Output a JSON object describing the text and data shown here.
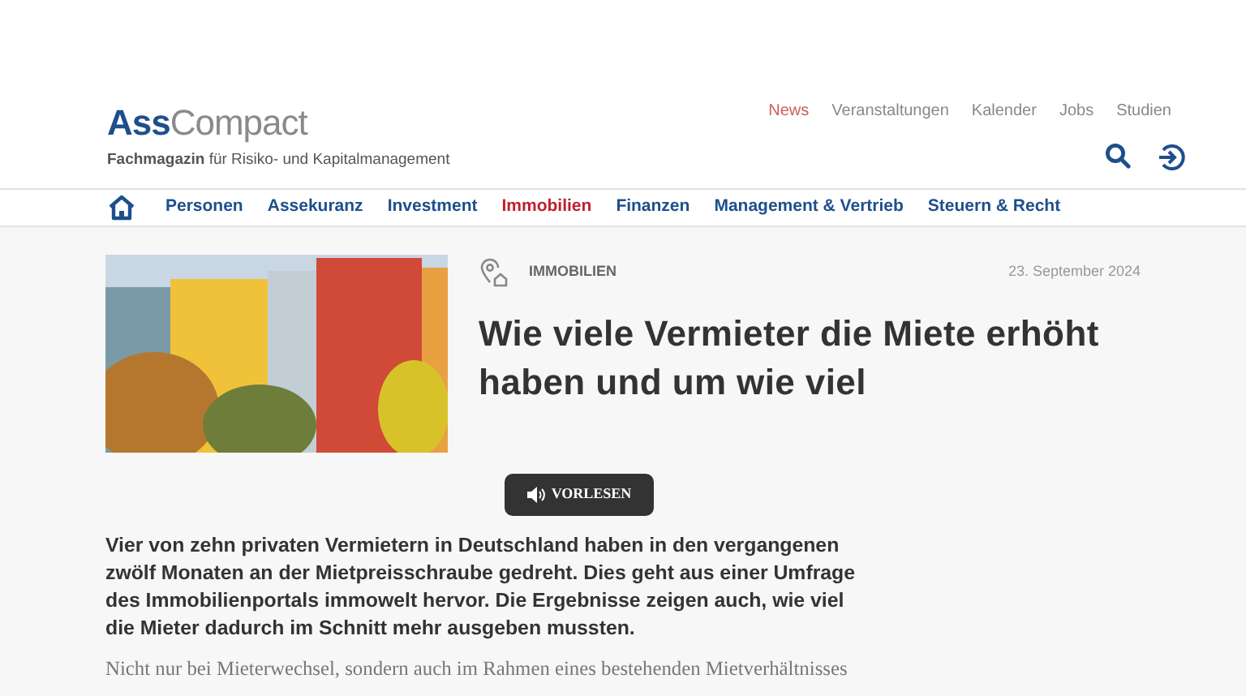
{
  "logo": {
    "part_1": "Ass",
    "part_2": "Compact",
    "tagline": "**Fachmagazin** für Risiko- und Kapitalmanagement"
  },
  "top_links": [
    {
      "label": "News",
      "selected": true
    },
    {
      "label": "Veranstaltungen",
      "selected": false
    },
    {
      "label": "Kalender",
      "selected": false
    },
    {
      "label": "Jobs",
      "selected": false
    },
    {
      "label": "Studien",
      "selected": false
    }
  ],
  "nav": [
    {
      "label": "Personen",
      "selected": false
    },
    {
      "label": "Assekuranz",
      "selected": false
    },
    {
      "label": "Investment",
      "selected": false
    },
    {
      "label": "Immobilien",
      "selected": true
    },
    {
      "label": "Finanzen",
      "selected": false
    },
    {
      "label": "Management & Vertrieb",
      "selected": false
    },
    {
      "label": "Steuern & Recht",
      "selected": false
    }
  ],
  "article": {
    "category": "IMMOBILIEN",
    "date": "23. September 2024",
    "title": "Wie viele Vermieter die Miete erhöht haben und um wie viel",
    "read_aloud": "VORLESEN",
    "lead": "Vier von zehn privaten Vermietern in Deutschland haben in den vergangenen zwölf Monaten an der Mietpreisschraube gedreht. Dies geht aus einer Umfrage des Immobilienportals immowelt hervor. Die Ergebnisse zeigen auch, wie viel die Mieter dadurch im Schnitt mehr ausgeben mussten.",
    "body": "Nicht nur bei Mieterwechsel, sondern auch im Rahmen eines bestehenden Mietverhältnisses"
  }
}
